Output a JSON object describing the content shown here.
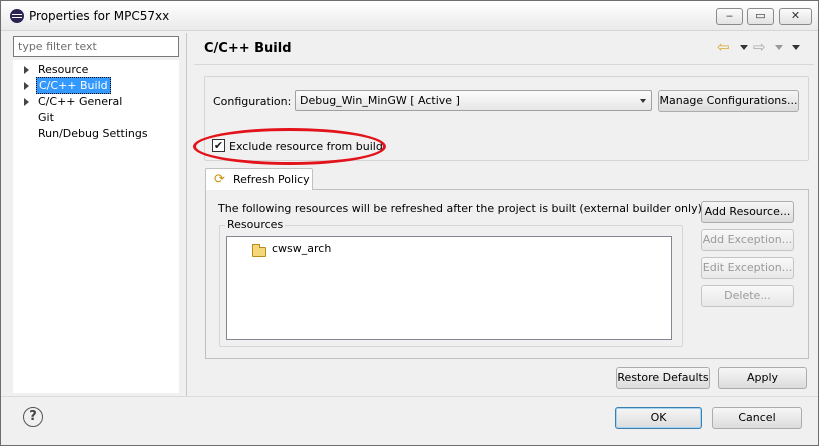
{
  "window": {
    "title": "Properties for MPC57xx",
    "controls": {
      "minimize": "‒",
      "maximize": "▭",
      "close": "✕"
    }
  },
  "sidebar": {
    "filter_placeholder": "type filter text",
    "items": [
      {
        "label": "Resource",
        "expandable": true
      },
      {
        "label": "C/C++ Build",
        "expandable": true,
        "selected": true
      },
      {
        "label": "C/C++ General",
        "expandable": true
      },
      {
        "label": "Git",
        "expandable": false
      },
      {
        "label": "Run/Debug Settings",
        "expandable": false
      }
    ]
  },
  "page": {
    "title": "C/C++ Build",
    "nav": {
      "back_icon": "back-arrow-icon",
      "forward_icon": "forward-arrow-icon"
    }
  },
  "configuration": {
    "label": "Configuration:",
    "selected": "Debug_Win_MinGW  [ Active ]",
    "manage_button": "Manage Configurations..."
  },
  "exclude": {
    "label": "Exclude resource from build",
    "checked": true,
    "check_glyph": "✔",
    "highlight_color": "#e2131b"
  },
  "tabs": [
    {
      "label": "Refresh Policy",
      "icon": "refresh-policy-icon"
    }
  ],
  "refresh_policy": {
    "description": "The following resources will be refreshed after the project is built (external builder only):",
    "resources_label": "Resources",
    "resources": [
      {
        "name": "cwsw_arch",
        "icon": "folder-icon"
      }
    ],
    "buttons": {
      "add_resource": "Add Resource...",
      "add_exception": "Add Exception...",
      "edit_exception": "Edit Exception...",
      "delete": "Delete..."
    }
  },
  "page_buttons": {
    "restore_defaults": "Restore Defaults",
    "apply": "Apply"
  },
  "dialog_buttons": {
    "ok": "OK",
    "cancel": "Cancel",
    "help_glyph": "?"
  }
}
